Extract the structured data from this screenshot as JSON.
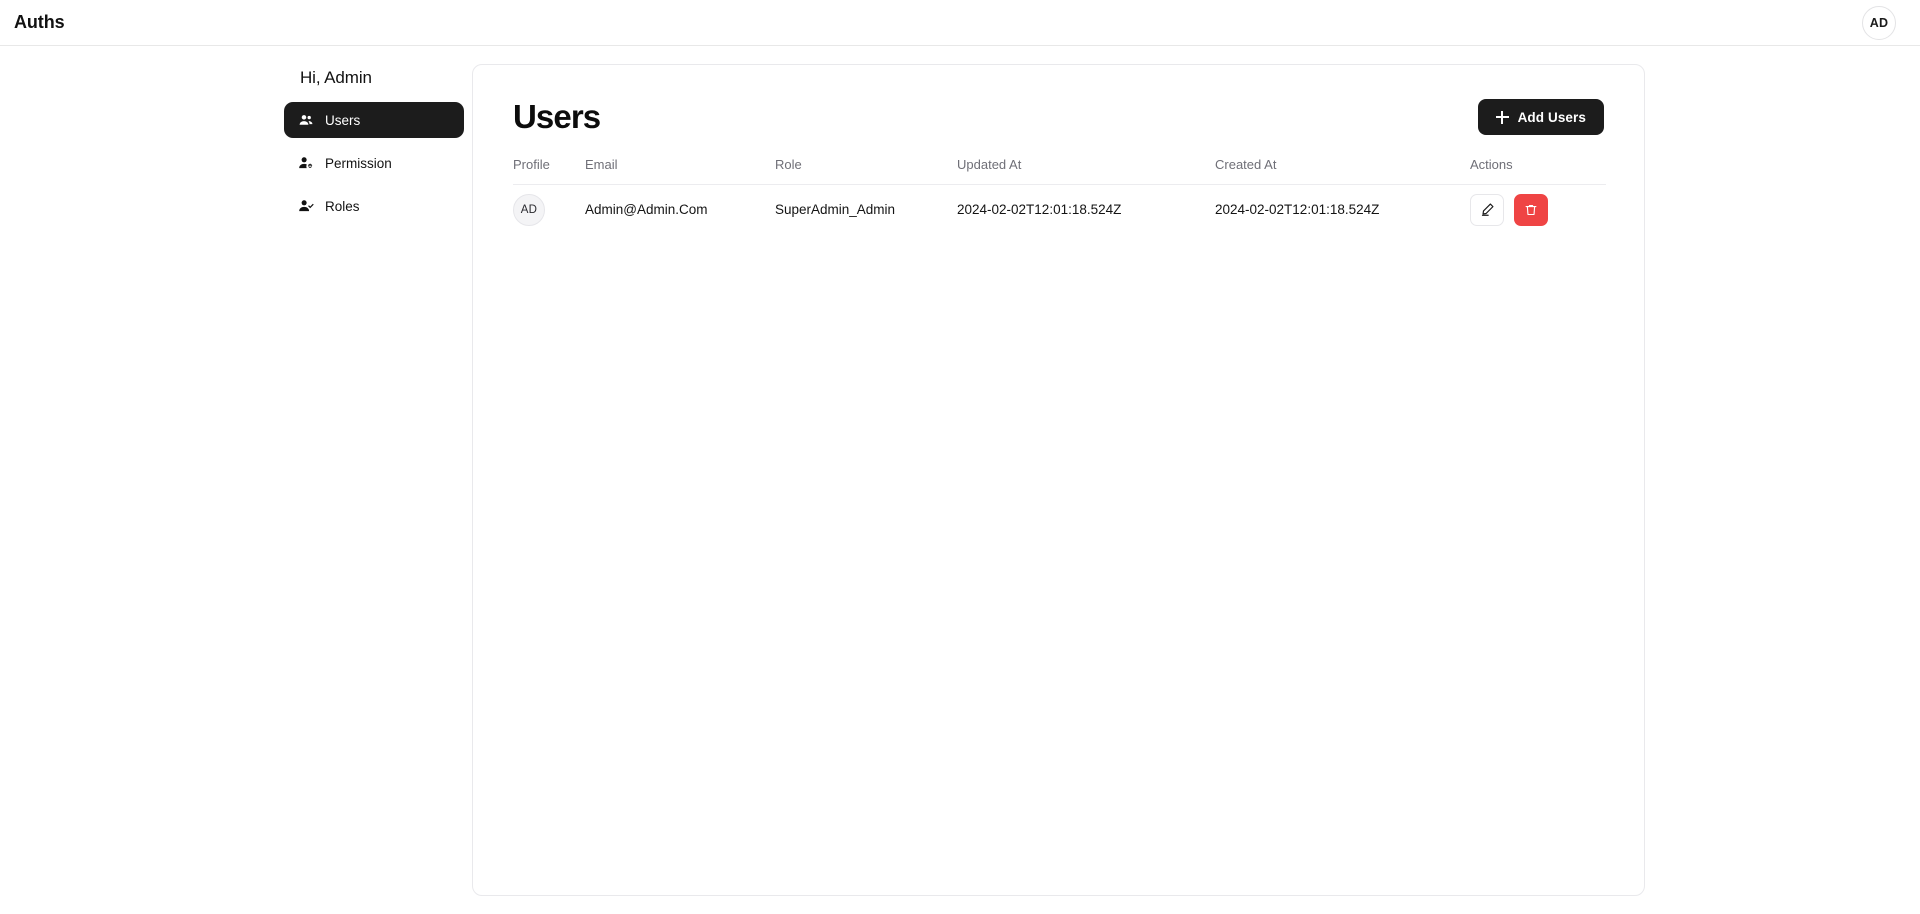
{
  "topbar": {
    "brand": "Auths",
    "avatar_initials": "AD"
  },
  "sidebar": {
    "greeting": "Hi, Admin",
    "items": [
      {
        "label": "Users",
        "icon": "users-group-icon",
        "active": true
      },
      {
        "label": "Permission",
        "icon": "user-gear-icon",
        "active": false
      },
      {
        "label": "Roles",
        "icon": "user-check-icon",
        "active": false
      }
    ]
  },
  "main": {
    "title": "Users",
    "add_button_label": "Add Users",
    "table": {
      "columns": [
        "Profile",
        "Email",
        "Role",
        "Updated At",
        "Created At",
        "Actions"
      ],
      "rows": [
        {
          "profile_initials": "AD",
          "email": "Admin@Admin.Com",
          "role": "SuperAdmin_Admin",
          "updated_at": "2024-02-02T12:01:18.524Z",
          "created_at": "2024-02-02T12:01:18.524Z",
          "edit_label": "Edit",
          "delete_label": "Delete"
        }
      ]
    }
  },
  "colors": {
    "accent_dark": "#1c1c1c",
    "danger": "#ef4444",
    "border": "#e9e9ec",
    "muted_text": "#6f6f77",
    "avatar_bg": "#f4f4f6"
  }
}
